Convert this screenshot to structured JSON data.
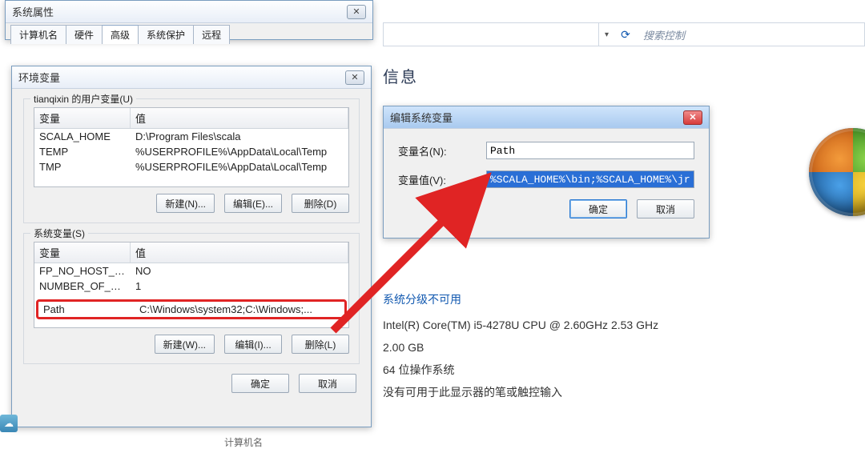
{
  "sysProps": {
    "title": "系统属性",
    "tabs": [
      "计算机名",
      "硬件",
      "高级",
      "系统保护",
      "远程"
    ],
    "activeTab": 2
  },
  "envVars": {
    "title": "环境变量",
    "userGroup": "tianqixin 的用户变量(U)",
    "sysGroup": "系统变量(S)",
    "colVar": "变量",
    "colVal": "值",
    "userRows": [
      {
        "name": "SCALA_HOME",
        "value": "D:\\Program Files\\scala"
      },
      {
        "name": "TEMP",
        "value": "%USERPROFILE%\\AppData\\Local\\Temp"
      },
      {
        "name": "TMP",
        "value": "%USERPROFILE%\\AppData\\Local\\Temp"
      }
    ],
    "sysRows": [
      {
        "name": "FP_NO_HOST_C...",
        "value": "NO"
      },
      {
        "name": "NUMBER_OF_PR...",
        "value": "1"
      },
      {
        "name": "Path",
        "value": "C:\\Windows\\system32;C:\\Windows;...",
        "highlighted": true
      }
    ],
    "btnNewU": "新建(N)...",
    "btnEditU": "编辑(E)...",
    "btnDelU": "删除(D)",
    "btnNewS": "新建(W)...",
    "btnEditS": "编辑(I)...",
    "btnDelS": "删除(L)",
    "btnOK": "确定",
    "btnCancel": "取消"
  },
  "editVar": {
    "title": "编辑系统变量",
    "nameLabel": "变量名(N):",
    "nameValue": "Path",
    "valueLabel": "变量值(V):",
    "valueValue": "%SCALA_HOME%\\bin;%SCALA_HOME%\\jre\\b",
    "btnOK": "确定",
    "btnCancel": "取消"
  },
  "topStrip": {
    "searchPlaceholder": "搜索控制"
  },
  "topHeader": "信息",
  "sysinfo": {
    "ratingHeader": "系统分级不可用",
    "cpu": "Intel(R) Core(TM) i5-4278U CPU @ 2.60GHz   2.53 GHz",
    "ram": "2.00 GB",
    "os": "64 位操作系统",
    "pen": "没有可用于此显示器的笔或触控输入"
  },
  "bottomCrumb": "计算机名"
}
